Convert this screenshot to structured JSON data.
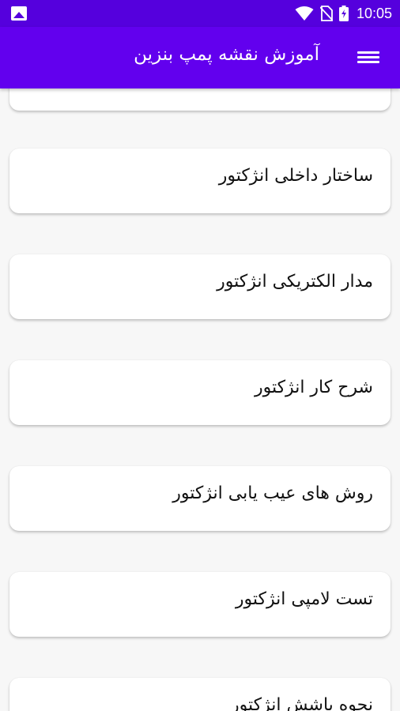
{
  "status_bar": {
    "time": "10:05"
  },
  "app_bar": {
    "title": "آموزش نقشه پمپ بنزین"
  },
  "items": [
    {
      "label": ""
    },
    {
      "label": "ساختار داخلی انژکتور"
    },
    {
      "label": "مدار الکتریکی انژکتور"
    },
    {
      "label": "شرح کار انژکتور"
    },
    {
      "label": "روش های عیب یابی انژکتور"
    },
    {
      "label": "تست لامپی انژکتور"
    },
    {
      "label": "نحوه باشش انژکتور"
    }
  ]
}
